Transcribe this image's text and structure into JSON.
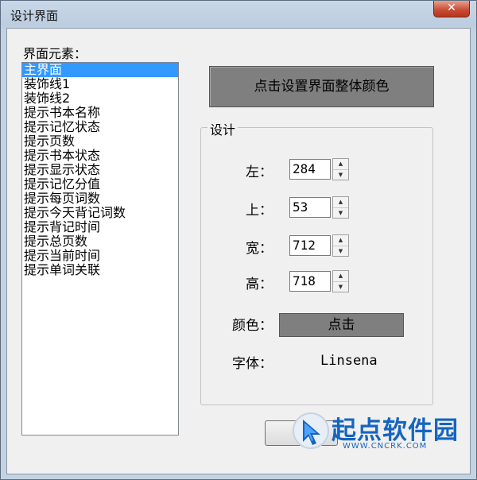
{
  "window": {
    "title": "设计界面",
    "close_glyph": "✕"
  },
  "elements": {
    "label": "界面元素：",
    "items": [
      "主界面",
      "装饰线1",
      "装饰线2",
      "提示书本名称",
      "提示记忆状态",
      "提示页数",
      "提示书本状态",
      "提示显示状态",
      "提示记忆分值",
      "提示每页词数",
      "提示今天背记词数",
      "提示背记时间",
      "提示总页数",
      "提示当前时间",
      "提示单词关联"
    ],
    "selected_index": 0
  },
  "actions": {
    "set_all_color_label": "点击设置界面整体颜色"
  },
  "design": {
    "group_title": "设计",
    "left_label": "左：",
    "left_value": "284",
    "top_label": "上：",
    "top_value": "53",
    "width_label": "宽：",
    "width_value": "712",
    "height_label": "高：",
    "height_value": "718",
    "color_label": "颜色：",
    "color_button_label": "点击",
    "font_label": "字体：",
    "font_value": "Linsena"
  },
  "watermark": {
    "title": "起点软件园",
    "url": "WWW.CNCRK.COM"
  },
  "colors": {
    "selection": "#3399ff",
    "button_gray": "#7f7f7f",
    "watermark_blue": "#1565c0"
  }
}
